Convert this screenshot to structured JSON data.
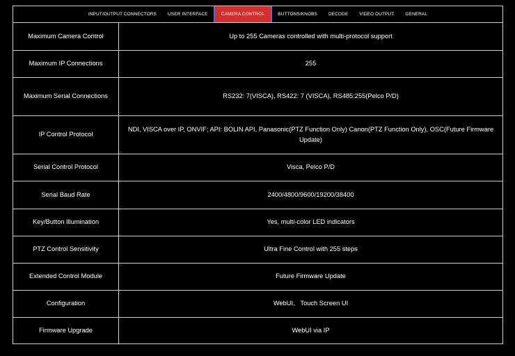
{
  "tabs": [
    {
      "label": "INPUT/OUTPUT CONNECTORS",
      "active": false
    },
    {
      "label": "USER INTERFACE",
      "active": false
    },
    {
      "label": "CAMERA CONTROL",
      "active": true
    },
    {
      "label": "BUTTONS/KNOBS",
      "active": false
    },
    {
      "label": "DECODE",
      "active": false
    },
    {
      "label": "VIDEO OUTPUT",
      "active": false
    },
    {
      "label": "GENERAL",
      "active": false
    }
  ],
  "colors": {
    "active_tab": "#d32f2f",
    "active_tab_border": "#4a74d8",
    "background": "#000000",
    "grid_lines": "#cfcfcf",
    "text": "#ffffff"
  },
  "specs": [
    {
      "label": "Maximum Camera Control",
      "value": "Up to 255 Cameras controlled with multi-protocol support"
    },
    {
      "label": "Maximum IP Connections",
      "value": "255"
    },
    {
      "label": "Maximum Serial Connections",
      "value": "RS232: 7(VISCA), RS422: 7 (VISCA), RS485:255(Pelco P/D)"
    },
    {
      "label": "IP Control Protocol",
      "value": "NDI, VISCA over IP, ONVIF; API: BOLIN API, Panasonic(PTZ Function Only) Canon(PTZ Function Only), OSC(Future Firmware Update)"
    },
    {
      "label": "Serial Control Protocol",
      "value": "Visca, Pelco P/D"
    },
    {
      "label": "Serial Baud Rate",
      "value": "2400/4800/9600/19200/38400"
    },
    {
      "label": "Key/Button Illumination",
      "value": "Yes, multi-color LED indicators"
    },
    {
      "label": "PTZ Control Sensitivity",
      "value": "Ultra Fine Control with 255 steps"
    },
    {
      "label": "Extended Control Module",
      "value": "Future Firmware Update"
    },
    {
      "label": "Configuration",
      "value": "WebUI,   Touch Screen UI"
    },
    {
      "label": "Firmware Upgrade",
      "value": "WebUI via IP"
    }
  ]
}
